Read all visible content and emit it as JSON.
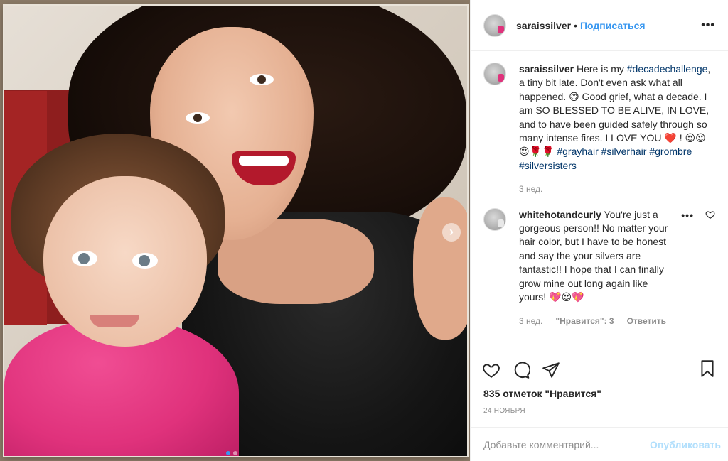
{
  "post": {
    "author": "saraissilver",
    "separator": "•",
    "follow_label": "Подписаться",
    "more_icon": "more-horizontal-icon",
    "next_icon": "chevron-right-icon"
  },
  "caption": {
    "user": "saraissilver",
    "text_1": " Here is my ",
    "tag_1": "#decadechallenge",
    "text_2": ", a tiny bit late. Don't even ask what all happened. 😅 Good grief, what a decade. I am SO BLESSED TO BE ALIVE, IN LOVE, and to have been guided safely through so many intense fires. I LOVE YOU ❤️ ! 😍😍😍🌹🌹 ",
    "tag_2": "#grayhair",
    "tag_3": "#silverhair",
    "tag_4": "#grombre",
    "tag_5": "#silversisters",
    "time": "3 нед."
  },
  "comment": {
    "user": "whitehotandcurly",
    "text": " You're just a gorgeous person!! No matter your hair color, but I have to be honest and say the your silvers are fantastic!! I hope that I can finally grow mine out long again like yours! 💖😍💖",
    "time": "3 нед.",
    "likes": "\"Нравится\": 3",
    "reply_label": "Ответить",
    "more": "•••"
  },
  "actions": {
    "like_icon": "heart-icon",
    "comment_icon": "comment-icon",
    "share_icon": "share-icon",
    "save_icon": "bookmark-icon"
  },
  "likes_count": "835 отметок \"Нравится\"",
  "date": "24 НОЯБРЯ",
  "add_comment": {
    "placeholder": "Добавьте комментарий...",
    "publish_label": "Опубликовать"
  },
  "carousel": {
    "index": 1,
    "total": 2
  }
}
